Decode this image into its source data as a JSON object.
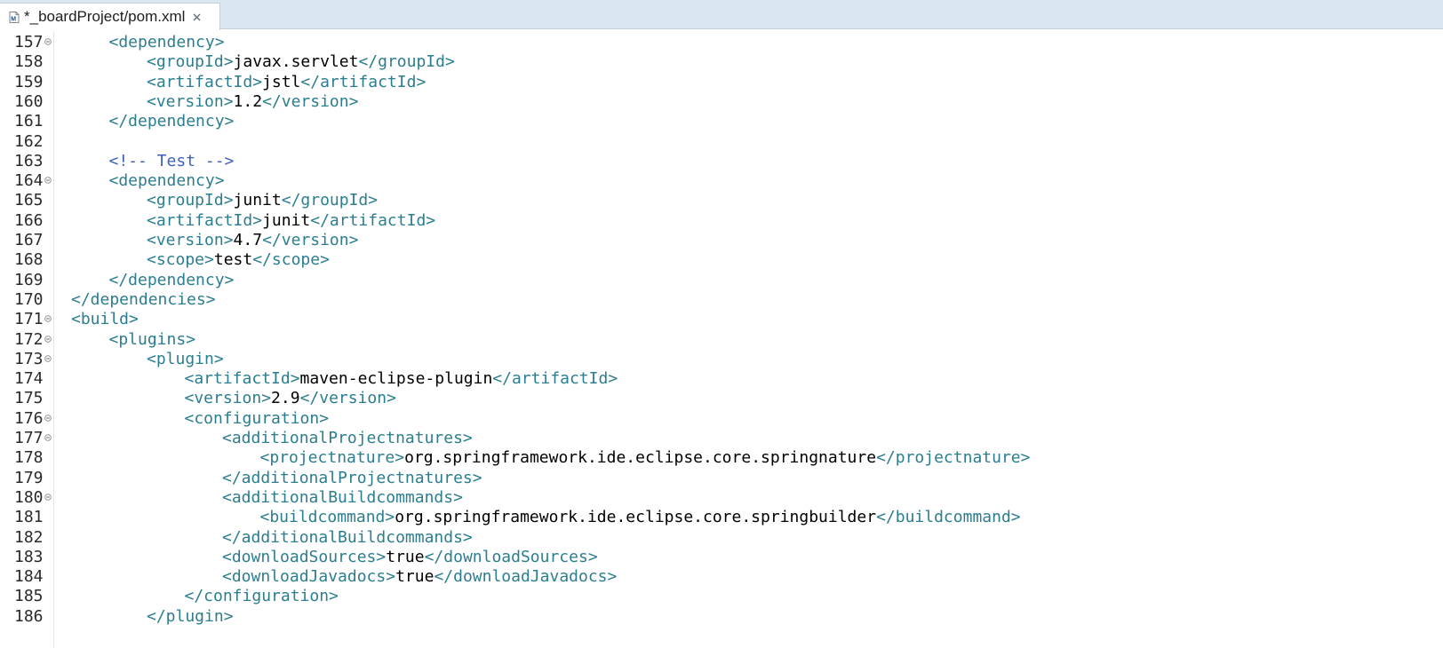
{
  "tab": {
    "title": "*_boardProject/pom.xml",
    "icon": "maven-file-icon",
    "close_icon": "close-icon"
  },
  "colors": {
    "tag": "#2b7e8f",
    "value": "#000000",
    "comment": "#3f5fbf",
    "tabbar": "#dbe6f3"
  },
  "lines": [
    {
      "num": "157",
      "fold": true,
      "indent": 2,
      "parts": [
        [
          "t",
          "<dependency>"
        ]
      ]
    },
    {
      "num": "158",
      "fold": false,
      "indent": 3,
      "parts": [
        [
          "t",
          "<groupId>"
        ],
        [
          "v",
          "javax.servlet"
        ],
        [
          "t",
          "</groupId>"
        ]
      ]
    },
    {
      "num": "159",
      "fold": false,
      "indent": 3,
      "parts": [
        [
          "t",
          "<artifactId>"
        ],
        [
          "v",
          "jstl"
        ],
        [
          "t",
          "</artifactId>"
        ]
      ]
    },
    {
      "num": "160",
      "fold": false,
      "indent": 3,
      "parts": [
        [
          "t",
          "<version>"
        ],
        [
          "v",
          "1.2"
        ],
        [
          "t",
          "</version>"
        ]
      ]
    },
    {
      "num": "161",
      "fold": false,
      "indent": 2,
      "parts": [
        [
          "t",
          "</dependency>"
        ]
      ]
    },
    {
      "num": "162",
      "fold": false,
      "indent": 0,
      "parts": []
    },
    {
      "num": "163",
      "fold": false,
      "indent": 2,
      "parts": [
        [
          "c",
          "<!-- Test -->"
        ]
      ]
    },
    {
      "num": "164",
      "fold": true,
      "indent": 2,
      "parts": [
        [
          "t",
          "<dependency>"
        ]
      ]
    },
    {
      "num": "165",
      "fold": false,
      "indent": 3,
      "parts": [
        [
          "t",
          "<groupId>"
        ],
        [
          "v",
          "junit"
        ],
        [
          "t",
          "</groupId>"
        ]
      ]
    },
    {
      "num": "166",
      "fold": false,
      "indent": 3,
      "parts": [
        [
          "t",
          "<artifactId>"
        ],
        [
          "v",
          "junit"
        ],
        [
          "t",
          "</artifactId>"
        ]
      ]
    },
    {
      "num": "167",
      "fold": false,
      "indent": 3,
      "parts": [
        [
          "t",
          "<version>"
        ],
        [
          "v",
          "4.7"
        ],
        [
          "t",
          "</version>"
        ]
      ]
    },
    {
      "num": "168",
      "fold": false,
      "indent": 3,
      "parts": [
        [
          "t",
          "<scope>"
        ],
        [
          "v",
          "test"
        ],
        [
          "t",
          "</scope>"
        ]
      ]
    },
    {
      "num": "169",
      "fold": false,
      "indent": 2,
      "parts": [
        [
          "t",
          "</dependency>"
        ]
      ]
    },
    {
      "num": "170",
      "fold": false,
      "indent": 1,
      "parts": [
        [
          "t",
          "</dependencies>"
        ]
      ]
    },
    {
      "num": "171",
      "fold": true,
      "indent": 1,
      "parts": [
        [
          "t",
          "<build>"
        ]
      ]
    },
    {
      "num": "172",
      "fold": true,
      "indent": 2,
      "parts": [
        [
          "t",
          "<plugins>"
        ]
      ]
    },
    {
      "num": "173",
      "fold": true,
      "indent": 3,
      "parts": [
        [
          "t",
          "<plugin>"
        ]
      ]
    },
    {
      "num": "174",
      "fold": false,
      "indent": 4,
      "parts": [
        [
          "t",
          "<artifactId>"
        ],
        [
          "v",
          "maven-eclipse-plugin"
        ],
        [
          "t",
          "</artifactId>"
        ]
      ]
    },
    {
      "num": "175",
      "fold": false,
      "indent": 4,
      "parts": [
        [
          "t",
          "<version>"
        ],
        [
          "v",
          "2.9"
        ],
        [
          "t",
          "</version>"
        ]
      ]
    },
    {
      "num": "176",
      "fold": true,
      "indent": 4,
      "parts": [
        [
          "t",
          "<configuration>"
        ]
      ]
    },
    {
      "num": "177",
      "fold": true,
      "indent": 5,
      "parts": [
        [
          "t",
          "<additionalProjectnatures>"
        ]
      ]
    },
    {
      "num": "178",
      "fold": false,
      "indent": 6,
      "parts": [
        [
          "t",
          "<projectnature>"
        ],
        [
          "v",
          "org.springframework.ide.eclipse.core.springnature"
        ],
        [
          "t",
          "</projectnature>"
        ]
      ]
    },
    {
      "num": "179",
      "fold": false,
      "indent": 5,
      "parts": [
        [
          "t",
          "</additionalProjectnatures>"
        ]
      ]
    },
    {
      "num": "180",
      "fold": true,
      "indent": 5,
      "parts": [
        [
          "t",
          "<additionalBuildcommands>"
        ]
      ]
    },
    {
      "num": "181",
      "fold": false,
      "indent": 6,
      "parts": [
        [
          "t",
          "<buildcommand>"
        ],
        [
          "v",
          "org.springframework.ide.eclipse.core.springbuilder"
        ],
        [
          "t",
          "</buildcommand>"
        ]
      ]
    },
    {
      "num": "182",
      "fold": false,
      "indent": 5,
      "parts": [
        [
          "t",
          "</additionalBuildcommands>"
        ]
      ]
    },
    {
      "num": "183",
      "fold": false,
      "indent": 5,
      "parts": [
        [
          "t",
          "<downloadSources>"
        ],
        [
          "v",
          "true"
        ],
        [
          "t",
          "</downloadSources>"
        ]
      ]
    },
    {
      "num": "184",
      "fold": false,
      "indent": 5,
      "parts": [
        [
          "t",
          "<downloadJavadocs>"
        ],
        [
          "v",
          "true"
        ],
        [
          "t",
          "</downloadJavadocs>"
        ]
      ]
    },
    {
      "num": "185",
      "fold": false,
      "indent": 4,
      "parts": [
        [
          "t",
          "</configuration>"
        ]
      ]
    },
    {
      "num": "186",
      "fold": false,
      "indent": 3,
      "parts": [
        [
          "t",
          "</plugin>"
        ]
      ]
    }
  ]
}
